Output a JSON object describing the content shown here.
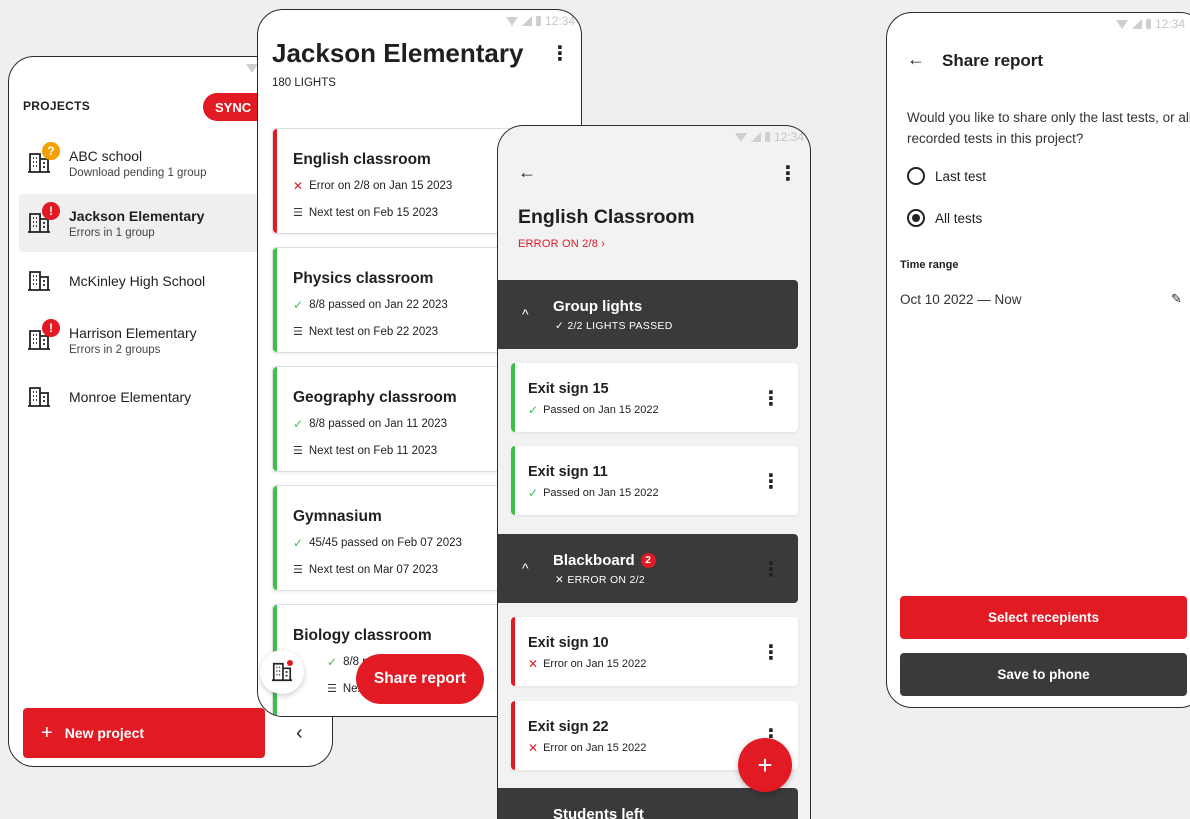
{
  "status_time": "12:34",
  "projects_screen": {
    "header": "PROJECTS",
    "sync_label": "SYNC",
    "items": [
      {
        "name": "ABC school",
        "status": "Download pending 1 group",
        "badge": "?"
      },
      {
        "name": "Jackson Elementary",
        "status": "Errors in 1 group",
        "badge": "!"
      },
      {
        "name": "McKinley High School",
        "status": "",
        "badge": ""
      },
      {
        "name": "Harrison Elementary",
        "status": "Errors in 2 groups",
        "badge": "!"
      },
      {
        "name": "Monroe Elementary",
        "status": "",
        "badge": ""
      }
    ],
    "new_project_label": "New project",
    "collapse_icon": "‹"
  },
  "school_screen": {
    "title": "Jackson Elementary",
    "subtitle": "180 LIGHTS",
    "rooms": [
      {
        "name": "English classroom",
        "result": "Error on 2/8 on Jan 15 2023",
        "next": "Next test on Feb 15 2023",
        "status": "error"
      },
      {
        "name": "Physics classroom",
        "result": "8/8 passed on Jan 22 2023",
        "next": "Next test on Feb 22 2023",
        "status": "ok"
      },
      {
        "name": "Geography classroom",
        "result": "8/8 passed on Jan 11 2023",
        "next": "Next test on Feb 11 2023",
        "status": "ok"
      },
      {
        "name": "Gymnasium",
        "result": "45/45 passed on Feb 07 2023",
        "next": "Next test on Mar 07 2023",
        "status": "ok"
      },
      {
        "name": "Biology classroom",
        "result": "8/8 passe",
        "next": "Next tes",
        "status": "ok"
      }
    ],
    "share_label": "Share report"
  },
  "classroom_screen": {
    "title": "English Classroom",
    "error_label": "ERROR ON 2/8",
    "groups": [
      {
        "name": "Group lights",
        "status": "2/2 LIGHTS PASSED",
        "badge": ""
      },
      {
        "name": "Blackboard",
        "status": "ERROR ON 2/2",
        "badge": "2"
      },
      {
        "name": "Students left",
        "status": "",
        "badge": ""
      }
    ],
    "items": [
      {
        "name": "Exit sign 15",
        "status": "Passed on Jan 15 2022",
        "ok": true
      },
      {
        "name": "Exit sign 11",
        "status": "Passed on Jan 15 2022",
        "ok": true
      },
      {
        "name": "Exit sign 10",
        "status": "Error on Jan 15 2022",
        "ok": false
      },
      {
        "name": "Exit sign 22",
        "status": "Error on Jan 15 2022",
        "ok": false
      }
    ],
    "fab_label": "+"
  },
  "share_screen": {
    "title": "Share report",
    "question": "Would you like to share only the last tests, or all recorded tests in this project?",
    "options": [
      {
        "label": "Last test",
        "selected": false
      },
      {
        "label": "All tests",
        "selected": true
      }
    ],
    "time_range_label": "Time range",
    "time_range_value": "Oct 10 2022 — Now",
    "select_recipients_label": "Select recepients",
    "save_label": "Save to phone"
  },
  "colors": {
    "accent": "#e11a24",
    "success": "#3cc04a",
    "warning": "#f5a000",
    "dark": "#3a3a3d"
  }
}
